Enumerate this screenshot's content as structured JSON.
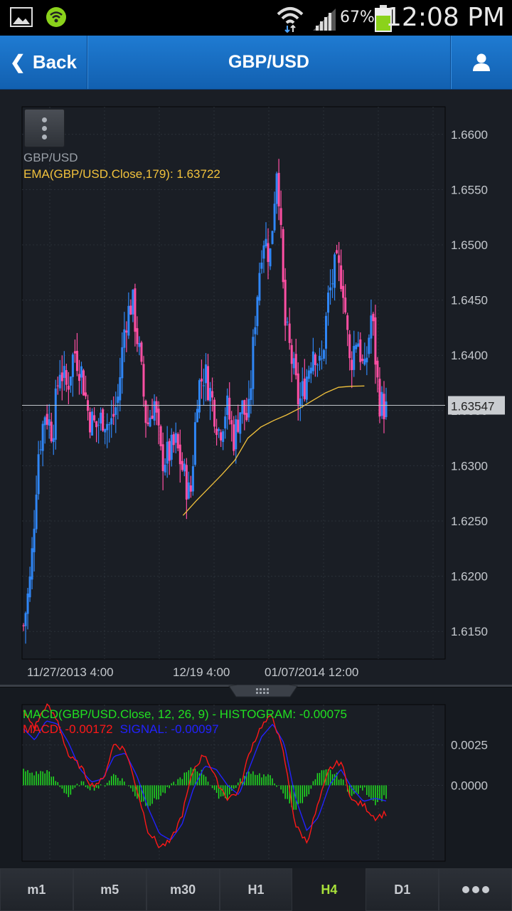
{
  "status_bar": {
    "time": "12:08 PM",
    "battery_percent": "67%",
    "icons": [
      "gallery-icon",
      "circle-app-icon",
      "wifi-icon",
      "signal-icon",
      "battery-icon"
    ]
  },
  "nav": {
    "back_label": "Back",
    "title": "GBP/USD",
    "user_icon": "user-icon"
  },
  "main_chart": {
    "symbol_label": "GBP/USD",
    "ema_label": "EMA(GBP/USD.Close,179): 1.63722",
    "current_price": "1.63547"
  },
  "macd_chart": {
    "histogram_label": "MACD(GBP/USD.Close, 12, 26, 9) - HISTOGRAM: -0.00075",
    "macd_label": "MACD: -0.00172",
    "signal_label": "SIGNAL: -0.00097"
  },
  "tabs": [
    {
      "label": "m1",
      "active": false
    },
    {
      "label": "m5",
      "active": false
    },
    {
      "label": "m30",
      "active": false
    },
    {
      "label": "H1",
      "active": false
    },
    {
      "label": "H4",
      "active": true
    },
    {
      "label": "D1",
      "active": false
    }
  ],
  "more_icon": "more-dots-icon",
  "colors": {
    "bull": "#2f86f6",
    "bear": "#ff4fa3",
    "ema": "#f2c23c",
    "histogram": "#21e121",
    "macd": "#ff1818",
    "signal": "#2222ff",
    "active_tab": "#a9e23a"
  },
  "chart_data": [
    {
      "type": "candlestick",
      "title": "GBP/USD",
      "y_ticks": [
        "1.6600",
        "1.6550",
        "1.6500",
        "1.6450",
        "1.6400",
        "1.6350",
        "1.6300",
        "1.6250",
        "1.6200",
        "1.6150"
      ],
      "x_ticks": [
        "11/27/2013 4:00",
        "12/19 4:00",
        "01/07/2014 12:00"
      ],
      "ylim": [
        1.6125,
        1.6625
      ],
      "current_price": 1.63547,
      "series": [
        {
          "name": "GBP/USD",
          "kind": "ohlc",
          "anchors": [
            1.6155,
            1.62,
            1.631,
            1.635,
            1.633,
            1.639,
            1.637,
            1.6405,
            1.6385,
            1.6345,
            1.6335,
            1.6345,
            1.6335,
            1.636,
            1.643,
            1.645,
            1.64,
            1.6335,
            1.636,
            1.6305,
            1.631,
            1.632,
            1.6295,
            1.627,
            1.637,
            1.6385,
            1.636,
            1.633,
            1.6355,
            1.6325,
            1.6355,
            1.634,
            1.644,
            1.651,
            1.649,
            1.658,
            1.643,
            1.6395,
            1.6355,
            1.638,
            1.641,
            1.6385,
            1.645,
            1.648,
            1.647,
            1.639,
            1.642,
            1.638,
            1.644,
            1.636,
            1.635
          ]
        },
        {
          "name": "EMA(GBP/USD.Close,179)",
          "kind": "line",
          "x_range": [
            0.44,
            0.94
          ],
          "values": [
            1.6255,
            1.6268,
            1.628,
            1.6292,
            1.6305,
            1.6325,
            1.6335,
            1.6341,
            1.6346,
            1.6352,
            1.6359,
            1.6366,
            1.6371,
            1.6372,
            1.63722
          ]
        }
      ]
    },
    {
      "type": "macd",
      "title": "MACD(GBP/USD.Close, 12, 26, 9)",
      "y_ticks": [
        "0.0025",
        "0.0000"
      ],
      "ylim": [
        -0.0047,
        0.005
      ],
      "series": [
        {
          "name": "MACD",
          "anchors": [
            0.0045,
            0.0036,
            0.005,
            0.004,
            0.0018,
            0.0012,
            0.0,
            0.0003,
            0.0026,
            0.0022,
            -0.0002,
            -0.0028,
            -0.0038,
            -0.0035,
            -0.0018,
            0.001,
            0.002,
            0.0003,
            -0.0008,
            -0.0004,
            0.0022,
            0.0037,
            0.0043,
            0.0018,
            -0.0025,
            -0.0035,
            -0.0012,
            0.001,
            0.0015,
            -0.001,
            -0.0012,
            -0.002,
            -0.00172
          ]
        },
        {
          "name": "SIGNAL",
          "anchors": [
            0.0035,
            0.0028,
            0.004,
            0.0038,
            0.0026,
            0.001,
            0.0002,
            0.0004,
            0.0018,
            0.002,
            0.0006,
            -0.0014,
            -0.003,
            -0.0034,
            -0.0024,
            -0.0002,
            0.0012,
            0.001,
            0.0,
            -0.0006,
            0.0012,
            0.003,
            0.0038,
            0.0026,
            -0.0008,
            -0.0028,
            -0.002,
            0.0,
            0.001,
            -0.0002,
            -0.001,
            -0.0008,
            -0.00097
          ]
        }
      ]
    }
  ]
}
